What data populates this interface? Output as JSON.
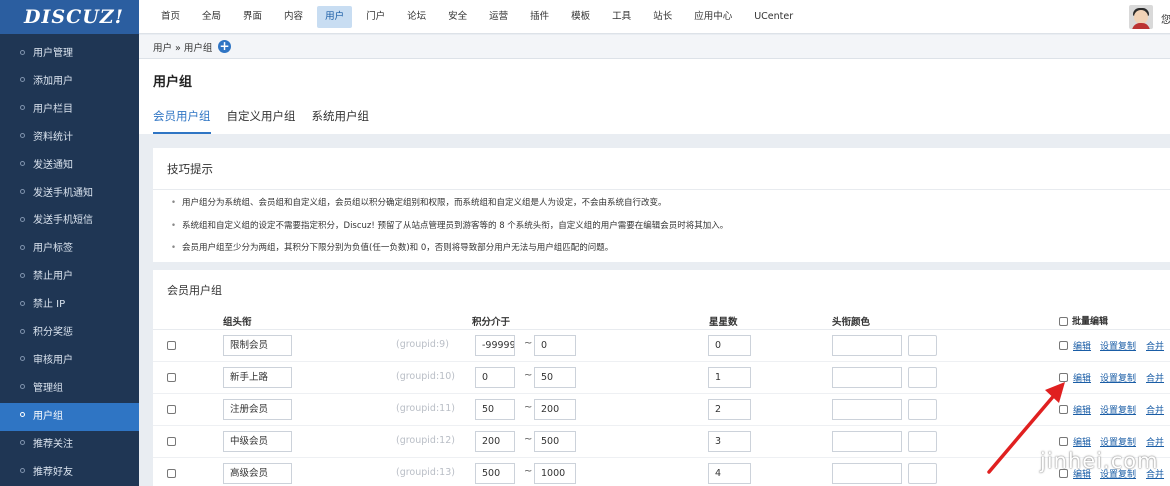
{
  "app": {
    "logo": "DISCUZ!"
  },
  "topnav": {
    "items": [
      {
        "label": "首页"
      },
      {
        "label": "全局"
      },
      {
        "label": "界面"
      },
      {
        "label": "内容"
      },
      {
        "label": "用户",
        "active": true
      },
      {
        "label": "门户"
      },
      {
        "label": "论坛"
      },
      {
        "label": "安全"
      },
      {
        "label": "运营"
      },
      {
        "label": "插件"
      },
      {
        "label": "模板"
      },
      {
        "label": "工具"
      },
      {
        "label": "站长"
      },
      {
        "label": "应用中心"
      },
      {
        "label": "UCenter"
      }
    ],
    "avatar_icon": "user-avatar",
    "extra": "您"
  },
  "sidebar": {
    "items": [
      {
        "label": "用户管理"
      },
      {
        "label": "添加用户"
      },
      {
        "label": "用户栏目"
      },
      {
        "label": "资料统计"
      },
      {
        "label": "发送通知"
      },
      {
        "label": "发送手机通知"
      },
      {
        "label": "发送手机短信"
      },
      {
        "label": "用户标签"
      },
      {
        "label": "禁止用户"
      },
      {
        "label": "禁止 IP"
      },
      {
        "label": "积分奖惩"
      },
      {
        "label": "审核用户"
      },
      {
        "label": "管理组"
      },
      {
        "label": "用户组",
        "active": true
      },
      {
        "label": "推荐关注"
      },
      {
        "label": "推荐好友"
      }
    ]
  },
  "breadcrumb": {
    "text": "用户 » 用户组",
    "plus_icon": "plus-circle-icon"
  },
  "page": {
    "title": "用户组",
    "tabs": [
      {
        "label": "会员用户组",
        "active": true
      },
      {
        "label": "自定义用户组"
      },
      {
        "label": "系统用户组"
      }
    ]
  },
  "tips": {
    "title": "技巧提示",
    "items": [
      "用户组分为系统组、会员组和自定义组，会员组以积分确定组别和权限，而系统组和自定义组是人为设定，不会由系统自行改变。",
      "系统组和自定义组的设定不需要指定积分，Discuz! 预留了从站点管理员到游客等的 8 个系统头衔，自定义组的用户需要在编辑会员时将其加入。",
      "会员用户组至少分为两组，其积分下限分别为负值(任一负数)和 0，否则将导致部分用户无法与用户组匹配的问题。"
    ]
  },
  "groups": {
    "title": "会员用户组",
    "headers": {
      "name": "组头衔",
      "points": "积分介于",
      "stars": "星星数",
      "color": "头衔颜色",
      "batch": "批量编辑"
    },
    "rows": [
      {
        "name": "限制会员",
        "gid": "(groupid:9)",
        "min": "-99999",
        "max": "0",
        "stars": "0"
      },
      {
        "name": "新手上路",
        "gid": "(groupid:10)",
        "min": "0",
        "max": "50",
        "stars": "1"
      },
      {
        "name": "注册会员",
        "gid": "(groupid:11)",
        "min": "50",
        "max": "200",
        "stars": "2"
      },
      {
        "name": "中级会员",
        "gid": "(groupid:12)",
        "min": "200",
        "max": "500",
        "stars": "3"
      },
      {
        "name": "高级会员",
        "gid": "(groupid:13)",
        "min": "500",
        "max": "1000",
        "stars": "4"
      }
    ],
    "tilde": "~",
    "actions": {
      "edit": "编辑",
      "copy": "设置复制",
      "merge": "合并"
    }
  },
  "annotation": {
    "arrow_color": "#e02020",
    "watermark": "jinhei.com"
  }
}
